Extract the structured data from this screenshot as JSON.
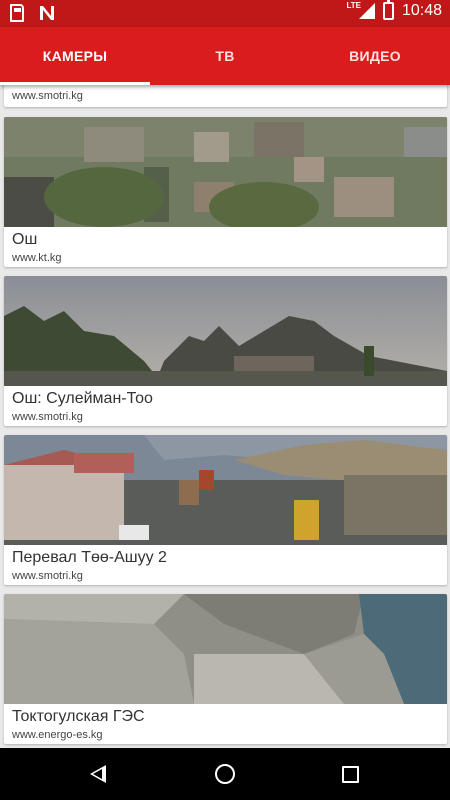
{
  "status_bar": {
    "time": "10:48",
    "network": "LTE",
    "icons": [
      "sd-card-icon",
      "notification-n-icon",
      "signal-icon",
      "battery-charging-icon"
    ]
  },
  "tabs": [
    {
      "label": "КАМЕРЫ",
      "selected": true
    },
    {
      "label": "ТВ",
      "selected": false
    },
    {
      "label": "ВИДЕО",
      "selected": false
    }
  ],
  "colors": {
    "status_bar": "#c01818",
    "app_bar": "#d91c1c",
    "background": "#e9e9e9"
  },
  "cameras": [
    {
      "title": "",
      "source": "www.smotri.kg"
    },
    {
      "title": "Ош",
      "source": "www.kt.kg"
    },
    {
      "title": "Ош: Сулейман-Тоо",
      "source": "www.smotri.kg"
    },
    {
      "title": "Перевал Төө-Ашуу 2",
      "source": "www.smotri.kg"
    },
    {
      "title": "Токтогулская ГЭС",
      "source": "www.energo-es.kg"
    }
  ],
  "nav_bar": {
    "buttons": [
      "back-icon",
      "home-icon",
      "recent-apps-icon"
    ]
  }
}
